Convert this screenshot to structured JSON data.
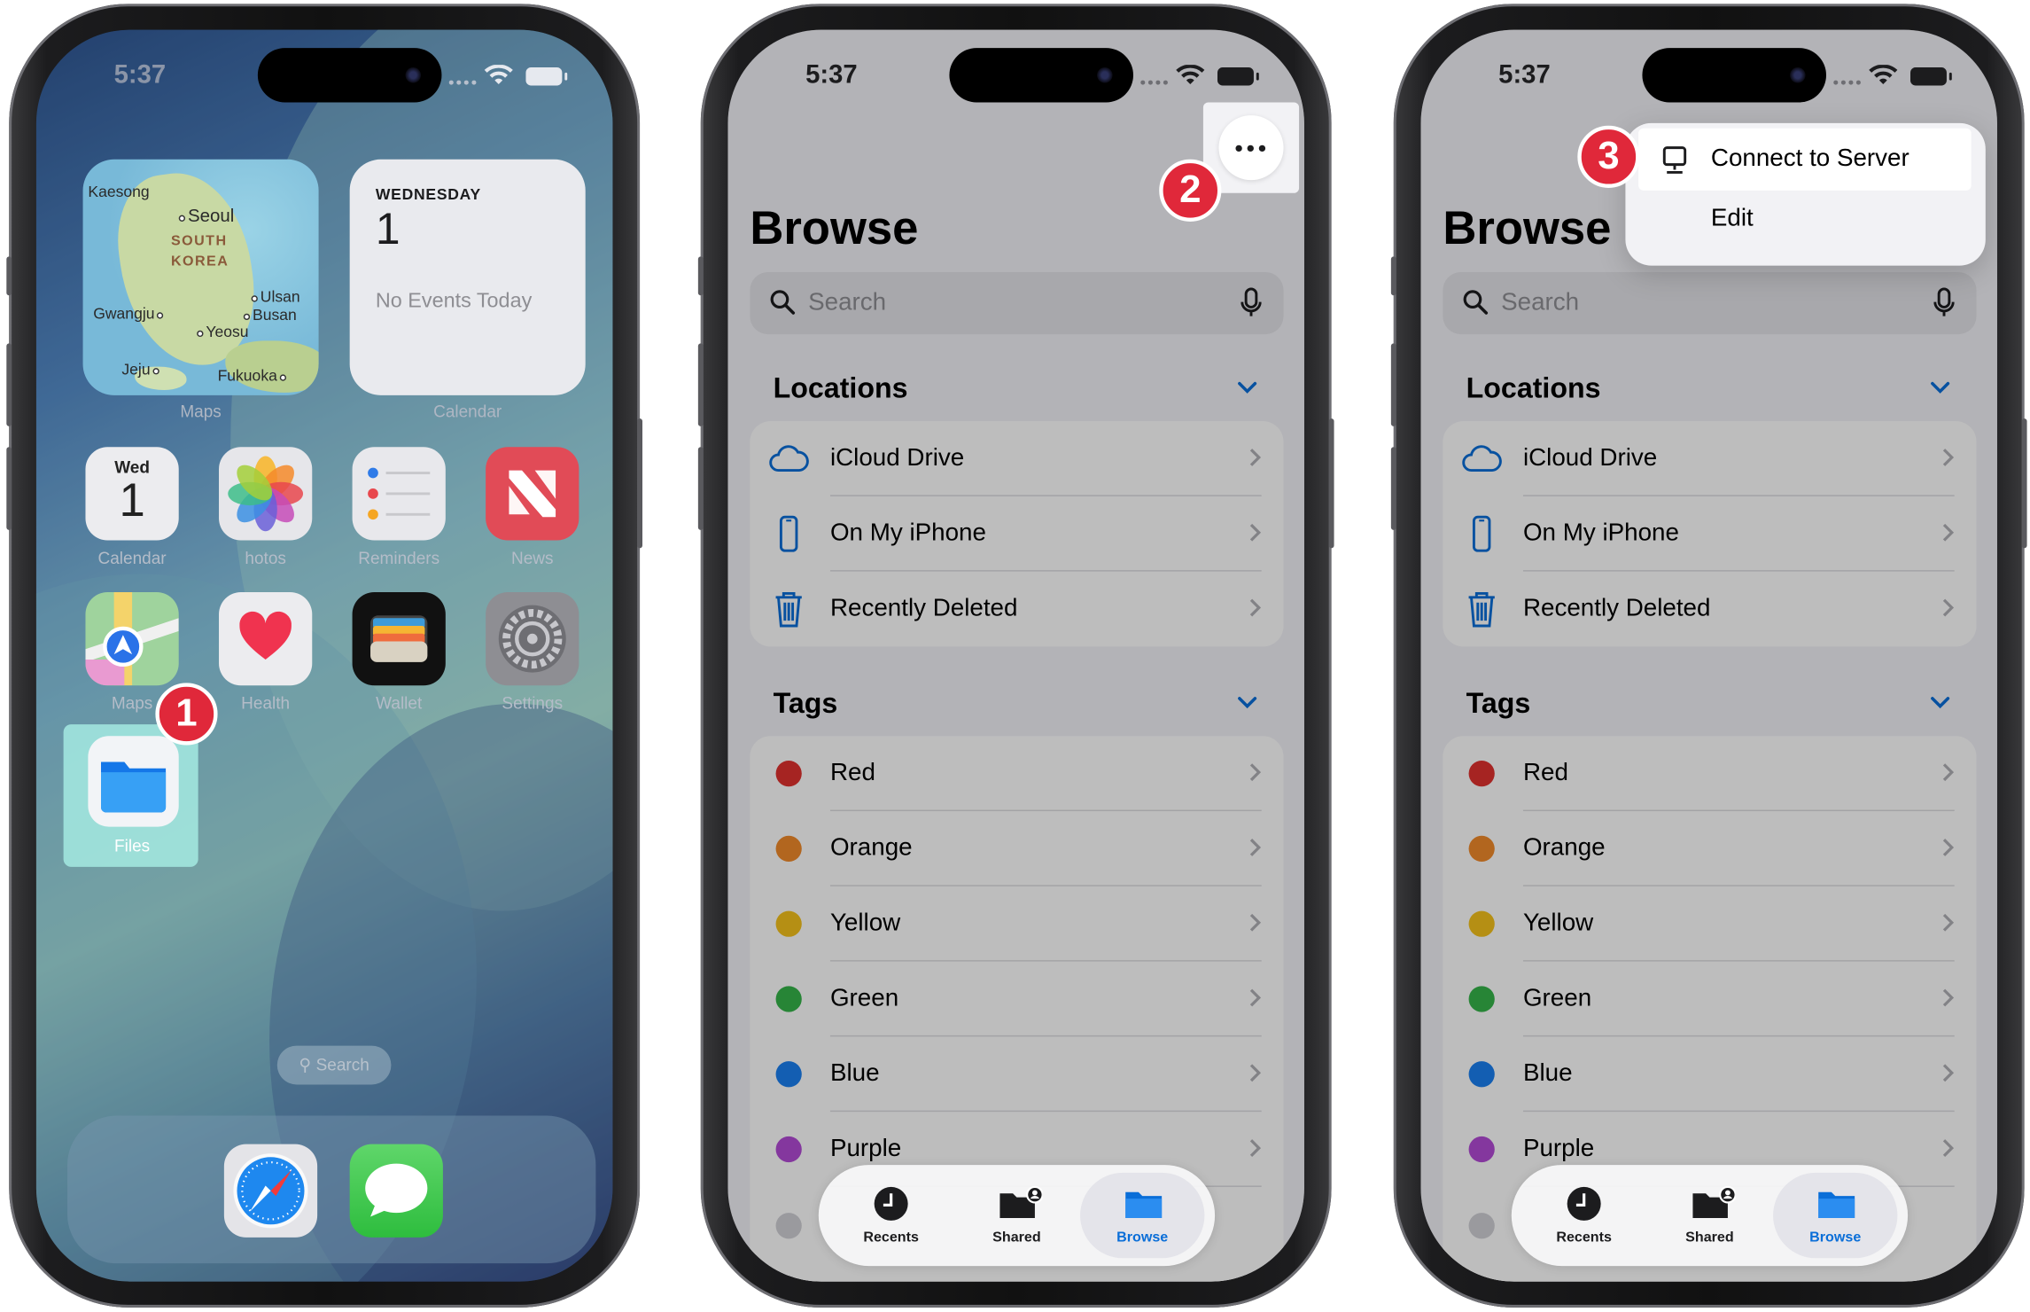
{
  "status": {
    "time": "5:37"
  },
  "home": {
    "map_widget": {
      "labels": {
        "kaesong": "Kaesong",
        "seoul": "Seoul",
        "south": "SOUTH",
        "korea": "KOREA",
        "gwangju": "Gwangju",
        "ulsan": "Ulsan",
        "busan": "Busan",
        "yeosu": "Yeosu",
        "jeju": "Jeju",
        "fukuoka": "Fukuoka"
      },
      "label": "Maps"
    },
    "calendar_widget": {
      "day": "WEDNESDAY",
      "date": "1",
      "events": "No Events Today",
      "label": "Calendar"
    },
    "apps": [
      {
        "label": "Calendar",
        "day": "Wed",
        "date": "1"
      },
      {
        "label": "hotos"
      },
      {
        "label": "Reminders"
      },
      {
        "label": "News"
      },
      {
        "label": "Maps"
      },
      {
        "label": "Health"
      },
      {
        "label": "Wallet"
      },
      {
        "label": "Settings"
      }
    ],
    "files_label": "Files",
    "search_label": "Search"
  },
  "browse": {
    "title": "Browse",
    "search_placeholder": "Search",
    "locations_header": "Locations",
    "locations": [
      "iCloud Drive",
      "On My iPhone",
      "Recently Deleted"
    ],
    "tags_header": "Tags",
    "tags": [
      {
        "name": "Red",
        "color": "#e0312f"
      },
      {
        "name": "Orange",
        "color": "#f18a2b"
      },
      {
        "name": "Yellow",
        "color": "#f4c21b"
      },
      {
        "name": "Green",
        "color": "#35b44a"
      },
      {
        "name": "Blue",
        "color": "#1a7ff0"
      },
      {
        "name": "Purple",
        "color": "#b24bd6"
      }
    ],
    "tabs": [
      "Recents",
      "Shared",
      "Browse"
    ],
    "active_tab": "Browse"
  },
  "menu": {
    "connect": "Connect to Server",
    "edit": "Edit"
  },
  "steps": [
    "1",
    "2",
    "3"
  ],
  "colors": {
    "accent": "#0a6ed8",
    "badge": "#e0283a"
  }
}
